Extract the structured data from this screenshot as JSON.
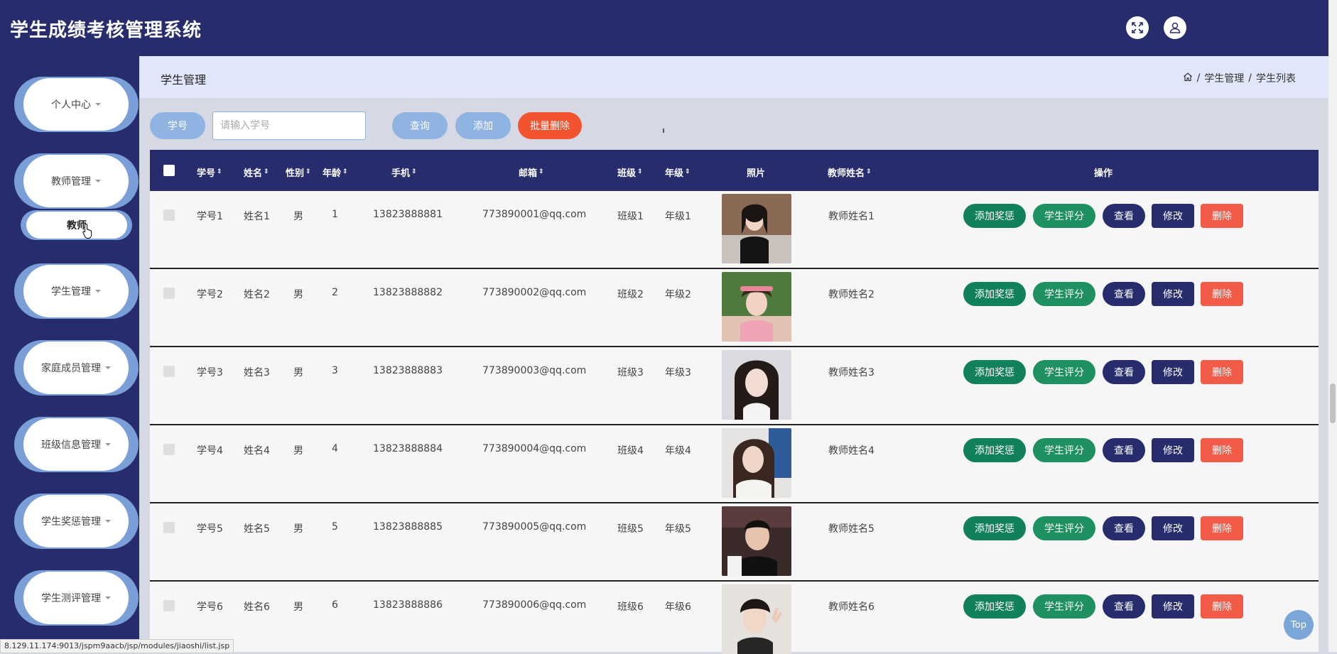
{
  "app": {
    "title": "学生成绩考核管理系统"
  },
  "header_icons": [
    "fullscreen-icon",
    "user-icon"
  ],
  "sidebar": {
    "items": [
      {
        "label": "个人中心"
      },
      {
        "label": "教师管理"
      },
      {
        "label": "学生管理"
      },
      {
        "label": "家庭成员管理"
      },
      {
        "label": "班级信息管理"
      },
      {
        "label": "学生奖惩管理"
      },
      {
        "label": "学生测评管理"
      }
    ],
    "submenu": {
      "label": "教师"
    }
  },
  "content": {
    "title": "学生管理",
    "breadcrumb": [
      "学生管理",
      "学生列表"
    ],
    "breadcrumb_sep": "/"
  },
  "toolbar": {
    "field_label": "学号",
    "search_placeholder": "请输入学号",
    "query_label": "查询",
    "add_label": "添加",
    "batch_delete_label": "批量删除"
  },
  "table": {
    "headers": {
      "student_no": "学号",
      "name": "姓名",
      "gender": "性别",
      "age": "年龄",
      "phone": "手机",
      "email": "邮箱",
      "class": "班级",
      "grade": "年级",
      "photo": "照片",
      "teacher": "教师姓名",
      "actions": "操作"
    },
    "actions": {
      "reward": "添加奖惩",
      "score": "学生评分",
      "view": "查看",
      "edit": "修改",
      "delete": "删除"
    },
    "rows": [
      {
        "student_no": "学号1",
        "name": "姓名1",
        "gender": "男",
        "age": "1",
        "phone": "13823888881",
        "email": "773890001@qq.com",
        "class": "班级1",
        "grade": "年级1",
        "teacher": "教师姓名1"
      },
      {
        "student_no": "学号2",
        "name": "姓名2",
        "gender": "男",
        "age": "2",
        "phone": "13823888882",
        "email": "773890002@qq.com",
        "class": "班级2",
        "grade": "年级2",
        "teacher": "教师姓名2"
      },
      {
        "student_no": "学号3",
        "name": "姓名3",
        "gender": "男",
        "age": "3",
        "phone": "13823888883",
        "email": "773890003@qq.com",
        "class": "班级3",
        "grade": "年级3",
        "teacher": "教师姓名3"
      },
      {
        "student_no": "学号4",
        "name": "姓名4",
        "gender": "男",
        "age": "4",
        "phone": "13823888884",
        "email": "773890004@qq.com",
        "class": "班级4",
        "grade": "年级4",
        "teacher": "教师姓名4"
      },
      {
        "student_no": "学号5",
        "name": "姓名5",
        "gender": "男",
        "age": "5",
        "phone": "13823888885",
        "email": "773890005@qq.com",
        "class": "班级5",
        "grade": "年级5",
        "teacher": "教师姓名5"
      },
      {
        "student_no": "学号6",
        "name": "姓名6",
        "gender": "男",
        "age": "6",
        "phone": "13823888886",
        "email": "773890006@qq.com",
        "class": "班级6",
        "grade": "年级6",
        "teacher": "教师姓名6"
      }
    ]
  },
  "back_to_top": "Top",
  "status_url": "8.129.11.174:9013/jspm9aacb/jsp/modules/jiaoshi/list.jsp",
  "colors": {
    "navy": "#262c6c",
    "light_blue": "#8fb4e2",
    "green": "#11805c",
    "red": "#f25b47",
    "orange": "#f25430"
  }
}
